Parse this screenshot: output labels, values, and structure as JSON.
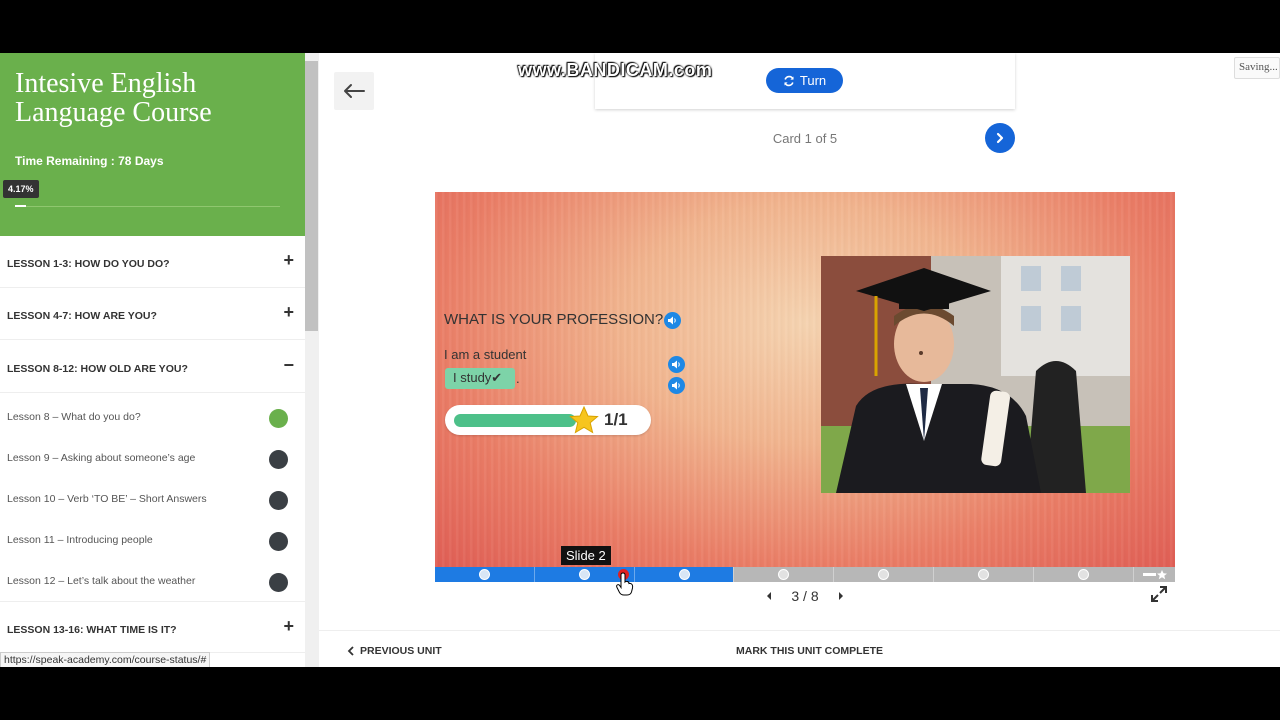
{
  "sidebar": {
    "course_title": "Intesive English Language Course",
    "time_remaining": "Time Remaining : 78 Days",
    "progress_pct": "4.17%",
    "progress_value": 4.17,
    "groups": [
      {
        "label": "LESSON 1-3: HOW DO YOU DO?",
        "toggle": "+"
      },
      {
        "label": "LESSON 4-7: HOW ARE YOU?",
        "toggle": "+"
      },
      {
        "label": "LESSON 8-12: HOW OLD ARE YOU?",
        "toggle": "−"
      },
      {
        "label": "LESSON 13-16: WHAT TIME IS IT?",
        "toggle": "+"
      }
    ],
    "lessons": [
      {
        "label": "Lesson 8 – What do you do?",
        "status": "done"
      },
      {
        "label": "Lesson 9 – Asking about someone’s age",
        "status": "pending"
      },
      {
        "label": "Lesson 10 – Verb ‘TO BE’ – Short Answers",
        "status": "pending"
      },
      {
        "label": "Lesson 11 – Introducing people",
        "status": "pending"
      },
      {
        "label": "Lesson 12 – Let’s talk about the weather",
        "status": "pending"
      }
    ],
    "status_url": "https://speak-academy.com/course-status/#"
  },
  "header": {
    "watermark": "www.BANDICAM.com",
    "turn_label": "Turn",
    "card_count": "Card 1 of 5",
    "saving": "Saving..."
  },
  "slide": {
    "question": "WHAT IS YOUR PROFESSION?",
    "answer_line": "I am a student",
    "chip_text": "I study✔",
    "chip_after": ".",
    "score": "1/1",
    "score_fraction": 1.0,
    "tooltip": "Slide 2",
    "pager": "3 / 8",
    "progress_fraction": 0.375
  },
  "footer": {
    "prev_unit": "PREVIOUS UNIT",
    "mark_complete": "MARK THIS UNIT COMPLETE"
  },
  "colors": {
    "sidebar_green": "#6ab04c",
    "accent_blue": "#1565d8",
    "dark_dot": "#3a3f44"
  }
}
